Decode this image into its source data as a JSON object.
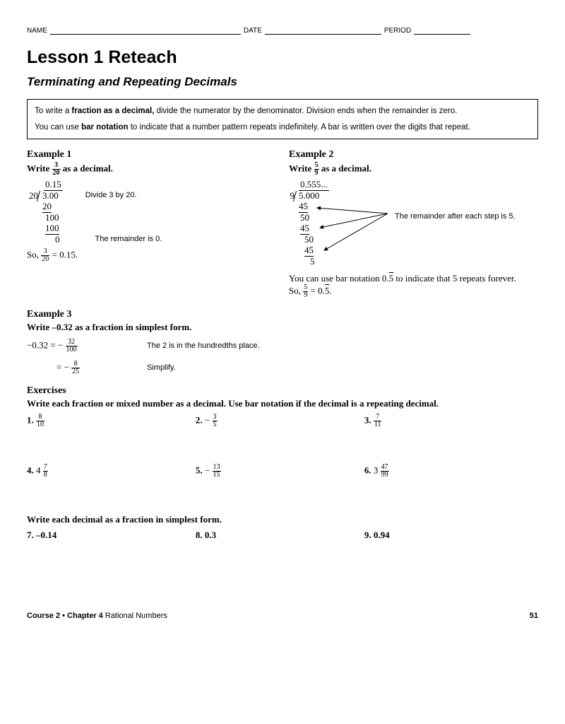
{
  "header": {
    "name": "NAME",
    "date": "DATE",
    "period": "PERIOD"
  },
  "title": "Lesson 1 Reteach",
  "subtitle": "Terminating and Repeating Decimals",
  "box": {
    "line1a": "To write a ",
    "line1b": "fraction as a decimal,",
    "line1c": " divide the numerator by the denominator. Division ends when the remainder is zero.",
    "line2a": "You can use ",
    "line2b": "bar notation",
    "line2c": " to indicate that a number pattern repeats indefinitely. A bar is written over the digits that repeat."
  },
  "ex1": {
    "title": "Example 1",
    "promptA": "Write ",
    "fracN": "3",
    "fracD": "20",
    "promptB": " as a decimal.",
    "quotient": "0.15",
    "divisor": "20",
    "dividend": "3.00",
    "note1": "Divide 3 by 20.",
    "w1": "20",
    "w2": "100",
    "w3": "100",
    "w4": "0",
    "note2": "The remainder is 0.",
    "soA": "So, ",
    "soB": " = 0.15."
  },
  "ex2": {
    "title": "Example 2",
    "promptA": "Write ",
    "fracN": "5",
    "fracD": "9",
    "promptB": " as a decimal.",
    "quotient": "0.555...",
    "divisor": "9",
    "dividend": "5.000",
    "w1": "45",
    "w2": "50",
    "w3": "45",
    "w4": "50",
    "w5": "45",
    "w6": "5",
    "note": "The remainder after each step is 5.",
    "barLine": "You can use bar notation 0.5̅ to indicate that 5 repeats forever.",
    "soA": "So, ",
    "soB": " = 0.5̅."
  },
  "ex3": {
    "title": "Example 3",
    "prompt": "Write –0.32 as a fraction in simplest form.",
    "l1a": "−0.32 = −",
    "f1n": "32",
    "f1d": "100",
    "note1": "The 2 is in the hundredths place.",
    "l2a": "= −",
    "f2n": "8",
    "f2d": "25",
    "note2": "Simplify."
  },
  "exercises": {
    "title": "Exercises",
    "prompt1": "Write each fraction or mixed number as a decimal. Use bar notation if the decimal is a repeating decimal.",
    "q1": {
      "n": "1.",
      "fn": "8",
      "fd": "10"
    },
    "q2": {
      "n": "2.",
      "pre": "−",
      "fn": "3",
      "fd": "5"
    },
    "q3": {
      "n": "3.",
      "fn": "7",
      "fd": "11"
    },
    "q4": {
      "n": "4.",
      "pre": "4",
      "fn": "7",
      "fd": "8"
    },
    "q5": {
      "n": "5.",
      "pre": "−",
      "fn": "13",
      "fd": "15"
    },
    "q6": {
      "n": "6.",
      "pre": "3",
      "fn": "47",
      "fd": "99"
    },
    "prompt2": "Write each decimal as a fraction in simplest form.",
    "q7": "7. –0.14",
    "q8": "8. 0.3",
    "q9": "9. 0.94"
  },
  "footer": {
    "leftA": "Course 2 • Chapter 4 ",
    "leftB": "Rational Numbers",
    "right": "51"
  }
}
